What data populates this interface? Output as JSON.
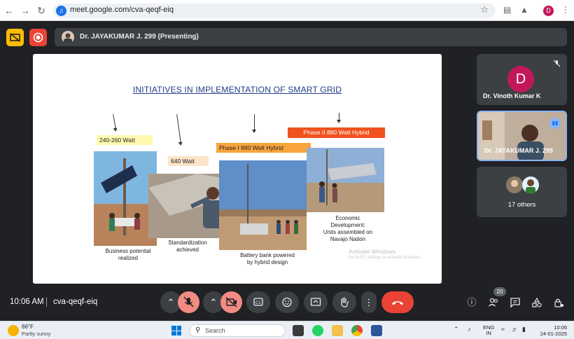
{
  "browser": {
    "url": "meet.google.com/cva-qeqf-eiq",
    "profile_initial": "D"
  },
  "meet": {
    "presenter_label": "Dr. JAYAKUMAR J. 299 (Presenting)",
    "time": "10:06 AM",
    "meeting_code": "cva-qeqf-eiq",
    "participants_badge": "20",
    "colors": {
      "end_call": "#ea4335",
      "muted": "#f28b82",
      "background": "#202124"
    }
  },
  "slide": {
    "title": "INITIATIVES IN IMPLEMENTATION OF SMART GRID",
    "labels": [
      "240-260 Watt",
      "640 Watt",
      "Phase I 880 Watt Hybrid",
      "Phase II 880 Watt Hybrid"
    ],
    "captions": [
      [
        "Business potential",
        "realized"
      ],
      [
        "Standardization",
        "achieved"
      ],
      [
        "Battery bank powered",
        "by hybrid design"
      ],
      [
        "Economic",
        "Development:",
        "Units assembled on",
        "Navajo Nation"
      ]
    ],
    "watermark": "Activate Windows",
    "watermark_sub": "Go to PC settings to activate Windows."
  },
  "participants": {
    "tile1": {
      "initial": "D",
      "name": "Dr. Vinoth Kumar K"
    },
    "tile2": {
      "name": "Dr. JAYAKUMAR J. 299"
    },
    "others": "17 others"
  },
  "taskbar": {
    "weather_temp": "66°F",
    "weather_desc": "Partly sunny",
    "search_placeholder": "Search",
    "lang_line1": "ENG",
    "lang_line2": "IN",
    "clock_time": "10:06",
    "clock_date": "24-01-2025"
  }
}
